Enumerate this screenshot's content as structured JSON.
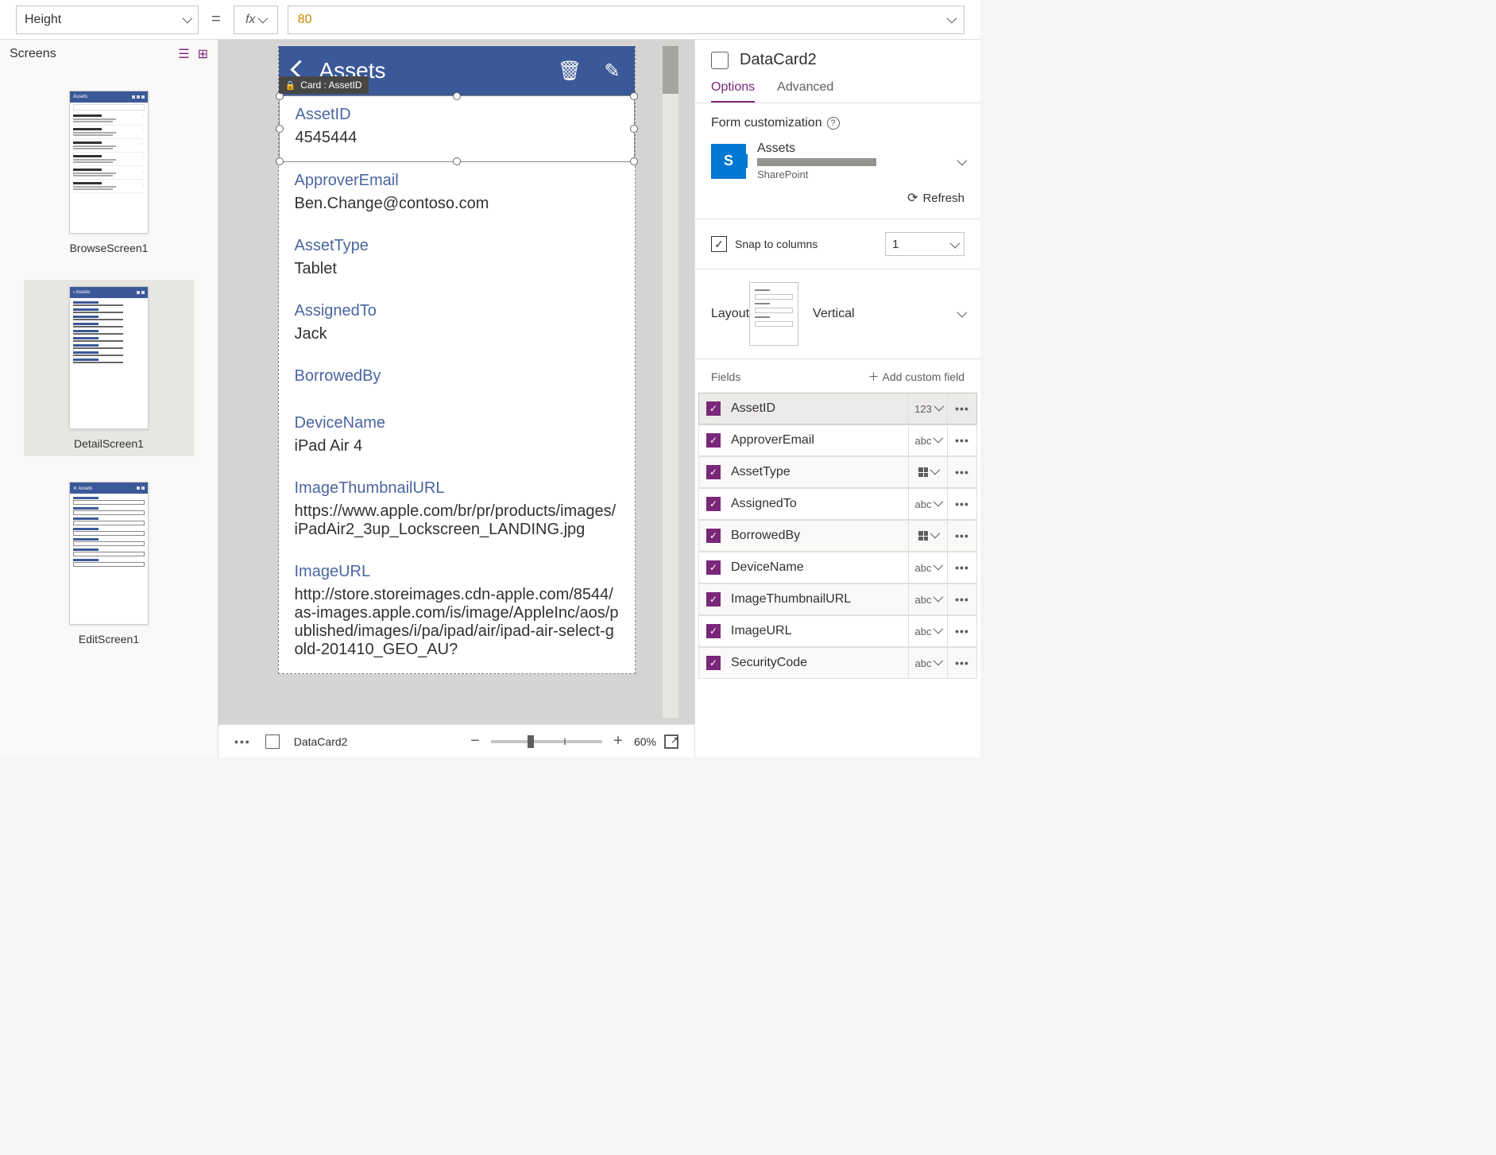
{
  "formula": {
    "property": "Height",
    "fx": "fx",
    "value": "80"
  },
  "screens": {
    "title": "Screens",
    "items": [
      {
        "name": "BrowseScreen1",
        "selected": false,
        "type": "browse"
      },
      {
        "name": "DetailScreen1",
        "selected": true,
        "type": "detail"
      },
      {
        "name": "EditScreen1",
        "selected": false,
        "type": "edit"
      }
    ],
    "thumbTitle": "Assets"
  },
  "canvas": {
    "tooltip": "Card : AssetID",
    "header": "Assets",
    "cards": [
      {
        "label": "AssetID",
        "value": "4545444",
        "selected": true
      },
      {
        "label": "ApproverEmail",
        "value": "Ben.Change@contoso.com"
      },
      {
        "label": "AssetType",
        "value": "Tablet"
      },
      {
        "label": "AssignedTo",
        "value": "Jack"
      },
      {
        "label": "BorrowedBy",
        "value": ""
      },
      {
        "label": "DeviceName",
        "value": "iPad Air 4"
      },
      {
        "label": "ImageThumbnailURL",
        "value": "https://www.apple.com/br/pr/products/images/iPadAir2_3up_Lockscreen_LANDING.jpg"
      },
      {
        "label": "ImageURL",
        "value": "http://store.storeimages.cdn-apple.com/8544/as-images.apple.com/is/image/AppleInc/aos/published/images/i/pa/ipad/air/ipad-air-select-gold-201410_GEO_AU?"
      }
    ]
  },
  "bottomBar": {
    "breadcrumb": "DataCard2",
    "zoom": "60%"
  },
  "props": {
    "title": "DataCard2",
    "tabs": {
      "options": "Options",
      "advanced": "Advanced"
    },
    "formCustomization": "Form customization",
    "dataSource": {
      "name": "Assets",
      "provider": "SharePoint"
    },
    "refresh": "Refresh",
    "snap": {
      "label": "Snap to columns",
      "value": "1"
    },
    "layout": {
      "label": "Layout",
      "value": "Vertical"
    },
    "fields": {
      "label": "Fields",
      "addCustom": "Add custom field",
      "items": [
        {
          "name": "AssetID",
          "type": "123",
          "selected": true
        },
        {
          "name": "ApproverEmail",
          "type": "abc"
        },
        {
          "name": "AssetType",
          "type": "grid"
        },
        {
          "name": "AssignedTo",
          "type": "abc"
        },
        {
          "name": "BorrowedBy",
          "type": "grid"
        },
        {
          "name": "DeviceName",
          "type": "abc"
        },
        {
          "name": "ImageThumbnailURL",
          "type": "abc"
        },
        {
          "name": "ImageURL",
          "type": "abc"
        },
        {
          "name": "SecurityCode",
          "type": "abc"
        }
      ]
    }
  }
}
